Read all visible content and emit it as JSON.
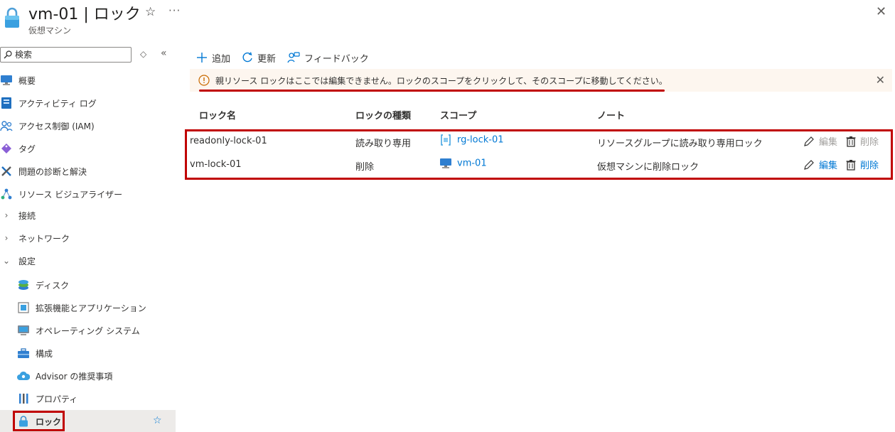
{
  "header": {
    "title": "vm-01 | ロック",
    "subtitle": "仮想マシン",
    "more_label": "···",
    "star_label": "☆",
    "close_label": "✕"
  },
  "sidebar": {
    "search_placeholder": "検索",
    "items": [
      {
        "label": "概要",
        "icon": "monitor-icon"
      },
      {
        "label": "アクティビティ ログ",
        "icon": "log-icon"
      },
      {
        "label": "アクセス制御 (IAM)",
        "icon": "people-icon"
      },
      {
        "label": "タグ",
        "icon": "tag-icon"
      },
      {
        "label": "問題の診断と解決",
        "icon": "wrench-icon"
      },
      {
        "label": "リソース ビジュアライザー",
        "icon": "visualizer-icon"
      },
      {
        "label": "接続",
        "icon": "chevron-right-icon"
      },
      {
        "label": "ネットワーク",
        "icon": "chevron-right-icon"
      },
      {
        "label": "設定",
        "icon": "chevron-down-icon"
      },
      {
        "label": "ディスク",
        "icon": "disk-icon"
      },
      {
        "label": "拡張機能とアプリケーション",
        "icon": "extension-icon"
      },
      {
        "label": "オペレーティング システム",
        "icon": "os-icon"
      },
      {
        "label": "構成",
        "icon": "toolbox-icon"
      },
      {
        "label": "Advisor の推奨事項",
        "icon": "advisor-icon"
      },
      {
        "label": "プロパティ",
        "icon": "properties-icon"
      },
      {
        "label": "ロック",
        "icon": "lock-icon"
      }
    ]
  },
  "toolbar": {
    "add_label": "追加",
    "refresh_label": "更新",
    "feedback_label": "フィードバック"
  },
  "info_bar": {
    "message": "親リソース ロックはここでは編集できません。ロックのスコープをクリックして、そのスコープに移動してください。"
  },
  "table": {
    "headers": [
      "ロック名",
      "ロックの種類",
      "スコープ",
      "ノート"
    ],
    "rows": [
      {
        "name": "readonly-lock-01",
        "type": "読み取り専用",
        "scope": "rg-lock-01",
        "note": "リソースグループに読み取り専用ロック",
        "edit": "編集",
        "delete": "削除",
        "actions_enabled": false
      },
      {
        "name": "vm-lock-01",
        "type": "削除",
        "scope": "vm-01",
        "note": "仮想マシンに削除ロック",
        "edit": "編集",
        "delete": "削除",
        "actions_enabled": true
      }
    ]
  },
  "colors": {
    "accent": "#0078d4",
    "highlight": "#c00000",
    "info_background": "#fdf6ef"
  }
}
